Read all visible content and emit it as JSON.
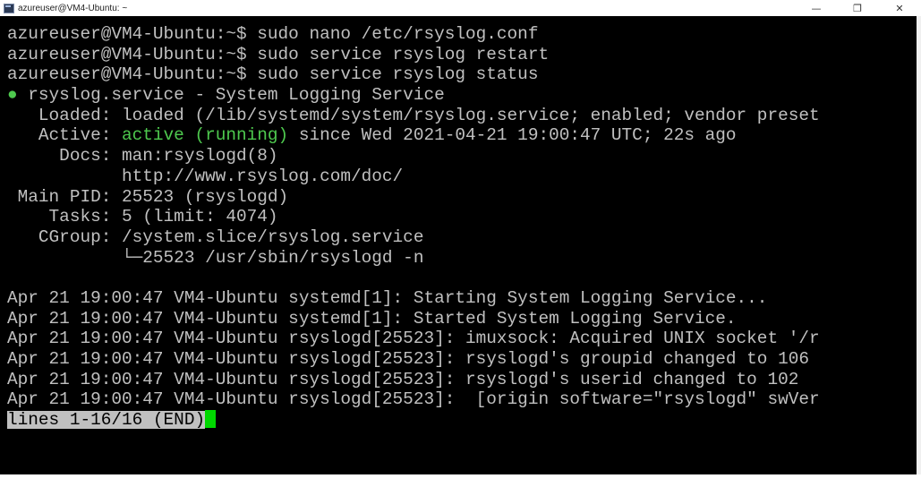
{
  "window": {
    "title": "azureuser@VM4-Ubuntu: ~",
    "icon": "terminal-icon",
    "controls": {
      "minimize": "—",
      "maximize": "❐",
      "close": "✕"
    }
  },
  "terminal": {
    "colors": {
      "background": "#000000",
      "text": "#c0c0c0",
      "accent": "#4ec94e",
      "cursor": "#00d800"
    },
    "lines": [
      "azureuser@VM4-Ubuntu:~$ sudo nano /etc/rsyslog.conf",
      "azureuser@VM4-Ubuntu:~$ sudo service rsyslog restart",
      "azureuser@VM4-Ubuntu:~$ sudo service rsyslog status"
    ],
    "status": {
      "bullet": "●",
      "header": " rsyslog.service - System Logging Service",
      "loaded": "   Loaded: loaded (/lib/systemd/system/rsyslog.service; enabled; vendor preset",
      "active_label": "   Active: ",
      "active_state": "active (running)",
      "active_since": " since Wed 2021-04-21 19:00:47 UTC; 22s ago",
      "docs_1": "     Docs: man:rsyslogd(8)",
      "docs_2": "           http://www.rsyslog.com/doc/",
      "main_pid": " Main PID: 25523 (rsyslogd)",
      "tasks": "    Tasks: 5 (limit: 4074)",
      "cgroup": "   CGroup: /system.slice/rsyslog.service",
      "cgroup_child": "           └─25523 /usr/sbin/rsyslogd -n"
    },
    "log": [
      "Apr 21 19:00:47 VM4-Ubuntu systemd[1]: Starting System Logging Service...",
      "Apr 21 19:00:47 VM4-Ubuntu systemd[1]: Started System Logging Service.",
      "Apr 21 19:00:47 VM4-Ubuntu rsyslogd[25523]: imuxsock: Acquired UNIX socket '/r",
      "Apr 21 19:00:47 VM4-Ubuntu rsyslogd[25523]: rsyslogd's groupid changed to 106",
      "Apr 21 19:00:47 VM4-Ubuntu rsyslogd[25523]: rsyslogd's userid changed to 102",
      "Apr 21 19:00:47 VM4-Ubuntu rsyslogd[25523]:  [origin software=\"rsyslogd\" swVer"
    ],
    "pager_status": "lines 1-16/16 (END)"
  }
}
